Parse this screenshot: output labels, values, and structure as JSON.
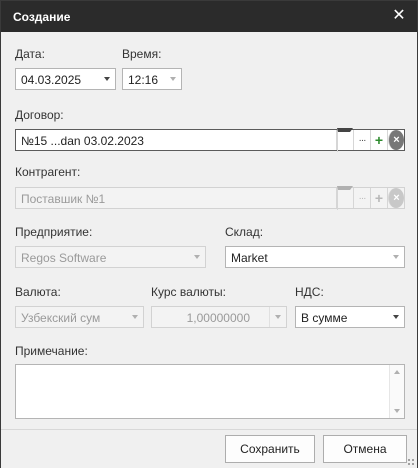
{
  "window": {
    "title": "Создание",
    "close_symbol": "✕"
  },
  "form": {
    "date": {
      "label": "Дата:",
      "value": "04.03.2025"
    },
    "time": {
      "label": "Время:",
      "value": "12:16"
    },
    "contract": {
      "label": "Договор:",
      "value": "№15 ...dan 03.02.2023",
      "enabled": true
    },
    "counterparty": {
      "label": "Контрагент:",
      "value": "Поставшик №1",
      "enabled": false
    },
    "enterprise": {
      "label": "Предприятие:",
      "value": "Regos Software",
      "enabled": false
    },
    "warehouse": {
      "label": "Склад:",
      "value": "Market",
      "enabled": true
    },
    "currency": {
      "label": "Валюта:",
      "value": "Узбекский сум",
      "enabled": false
    },
    "rate": {
      "label": "Курс валюты:",
      "value": "1,00000000",
      "enabled": false
    },
    "vat": {
      "label": "НДС:",
      "value": "В сумме",
      "enabled": true
    },
    "note": {
      "label": "Примечание:",
      "value": ""
    }
  },
  "icons": {
    "ellipsis": "···",
    "plus": "+",
    "clear": "×"
  },
  "footer": {
    "save_label": "Сохранить",
    "cancel_label": "Отмена"
  },
  "colors": {
    "titlebar": "#2b2b2b",
    "plus_green": "#2e8b2e",
    "window_bg": "#f0f0f0"
  }
}
